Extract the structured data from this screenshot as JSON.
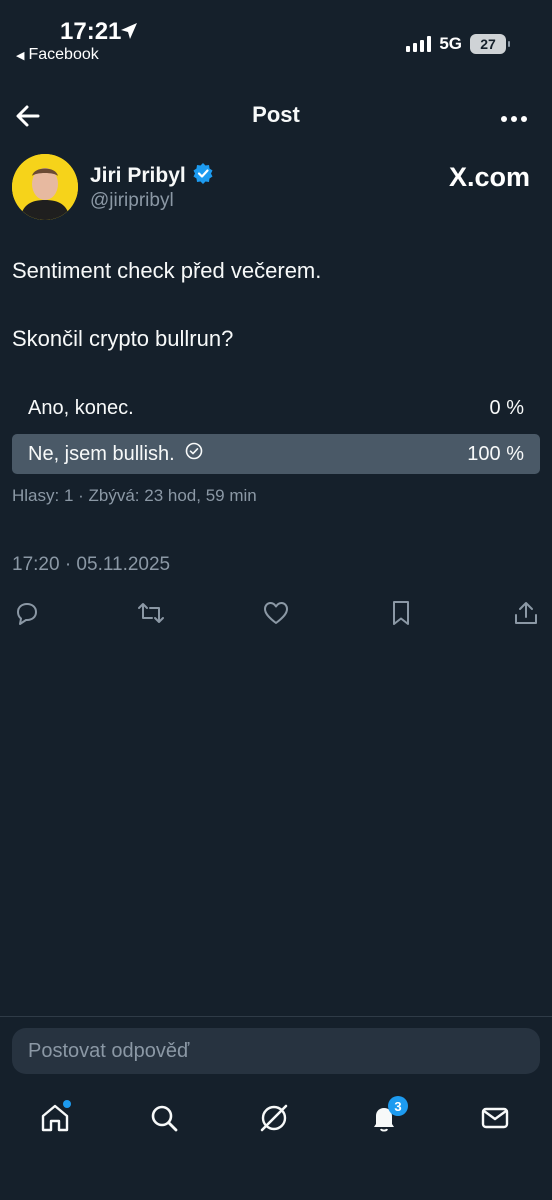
{
  "status_bar": {
    "time": "17:21",
    "back_app": "Facebook",
    "network": "5G",
    "battery": "27"
  },
  "header": {
    "title": "Post"
  },
  "author": {
    "name": "Jiri Pribyl",
    "handle": "@jiripribyl",
    "verified": true,
    "source_logo": "X.com"
  },
  "post": {
    "line1": "Sentiment check před večerem.",
    "line2": "Skončil crypto bullrun?",
    "poll": {
      "options": [
        {
          "label": "Ano, konec.",
          "percent_text": "0 %",
          "percent": 0,
          "selected": false
        },
        {
          "label": "Ne, jsem bullish.",
          "percent_text": "100 %",
          "percent": 100,
          "selected": true
        }
      ],
      "meta": "Hlasy: 1 · Zbývá: 23 hod, 59 min"
    },
    "timestamp": "17:20 · 05.11.2025"
  },
  "actions": [
    "reply-icon",
    "repost-icon",
    "like-icon",
    "bookmark-icon",
    "share-icon"
  ],
  "reply_box": {
    "placeholder": "Postovat odpověď"
  },
  "bottom_nav": {
    "notifications_badge": "3"
  },
  "colors": {
    "background": "#15202b",
    "accent": "#1d9bf0",
    "muted": "#8b98a5",
    "poll_winner": "#4a5967"
  }
}
